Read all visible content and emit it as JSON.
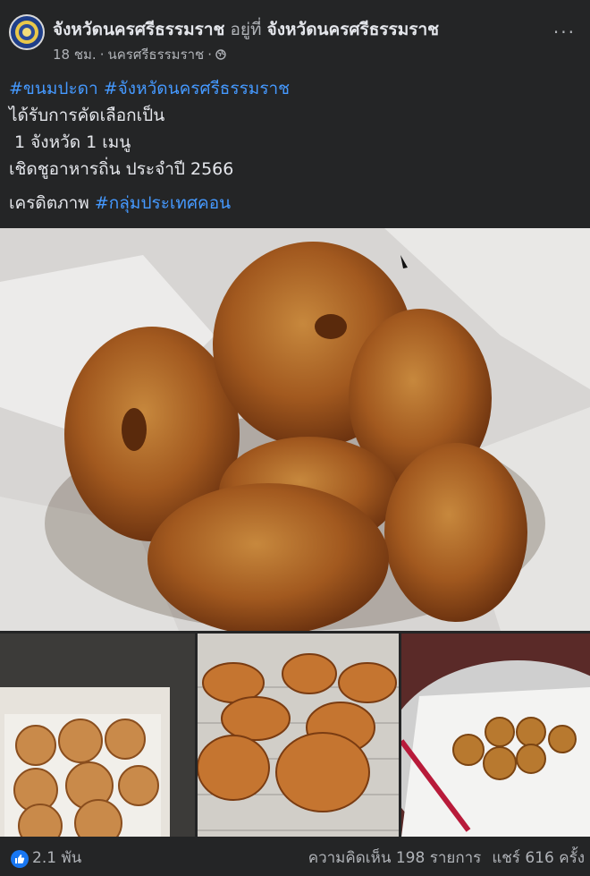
{
  "post": {
    "author": "จังหวัดนครศรีธรรมราช",
    "at_text": "อยู่ที่",
    "location": "จังหวัดนครศรีธรรมราช",
    "time": "18 ชม.",
    "place": "นครศรีธรรมราช",
    "separator": "·",
    "more": "···",
    "hashtag1": "#ขนมปะดา",
    "hashtag2": "#จังหวัดนครศรีธรรมราช",
    "line2": "ได้รับการคัดเลือกเป็น",
    "line3": " 1 จังหวัด 1 เมนู",
    "line4": "เชิดชูอาหารถิ่น ประจำปี 2566",
    "credit_label": "เครดิตภาพ",
    "credit_tag": "#กลุ่มประเทศคอน"
  },
  "stats": {
    "likes": "2.1 พัน",
    "comments": "ความคิดเห็น 198 รายการ",
    "shares": "แชร์ 616 ครั้ง"
  },
  "icons": {
    "avatar": "seal-icon",
    "privacy": "globe-icon",
    "reaction": "like-icon"
  },
  "colors": {
    "background": "#242526",
    "text": "#e4e6eb",
    "secondary": "#b0b3b8",
    "hashtag": "#4599ff",
    "like": "#1877f2"
  }
}
